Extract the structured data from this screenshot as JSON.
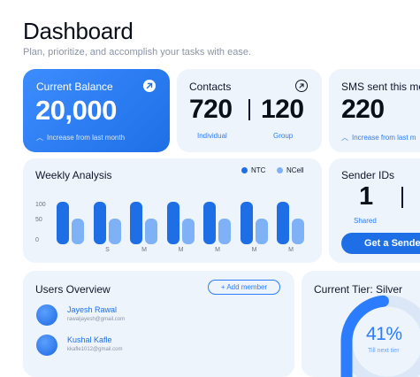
{
  "header": {
    "title": "Dashboard",
    "subtitle": "Plan, prioritize, and accomplish your tasks with ease."
  },
  "cards": {
    "balance": {
      "title": "Current Balance",
      "value": "20,000",
      "trend": "Increase from last month"
    },
    "contacts": {
      "title": "Contacts",
      "individual_value": "720",
      "group_value": "120",
      "individual_label": "Individual",
      "group_label": "Group"
    },
    "sms": {
      "title": "SMS sent this mon",
      "value": "220",
      "trend": "Increase from last m"
    },
    "weekly": {
      "title": "Weekly Analysis",
      "legend": [
        {
          "name": "NTC",
          "color": "#1e6fe6"
        },
        {
          "name": "NCell",
          "color": "#7fb1f7"
        }
      ]
    },
    "sender": {
      "title": "Sender IDs",
      "value": "1",
      "shared_label": "Shared",
      "button": "Get a Sende"
    },
    "users": {
      "title": "Users Overview",
      "add_button": "+ Add member",
      "list": [
        {
          "name": "Jayesh Rawal",
          "email": "rawaljayesh@gmail.com"
        },
        {
          "name": "Kushal Kafle",
          "email": "kkafle1012@gmail.com"
        }
      ]
    },
    "tier": {
      "title": "Current Tier: Silver",
      "percent": "41%",
      "percent_value": 41,
      "subtitle": "Till next tier"
    }
  },
  "chart_data": {
    "type": "bar",
    "categories": [
      "",
      "S",
      "M",
      "M",
      "M",
      "M",
      "M"
    ],
    "y_ticks": [
      "100",
      "50",
      "0"
    ],
    "ylim": [
      0,
      100
    ],
    "series": [
      {
        "name": "NTC",
        "values": [
          100,
          100,
          100,
          100,
          100,
          100,
          100
        ]
      },
      {
        "name": "NCell",
        "values": [
          60,
          60,
          60,
          60,
          60,
          60,
          60
        ]
      }
    ],
    "legend_placement": "top-right"
  }
}
